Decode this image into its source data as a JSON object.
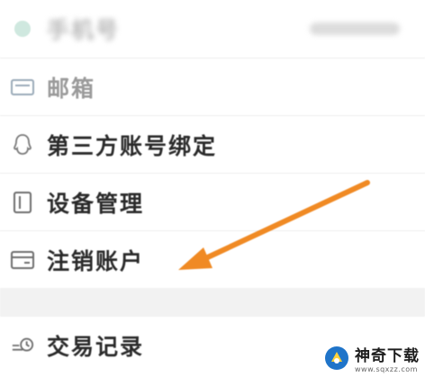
{
  "menu": {
    "top_label": "手机号",
    "mailbox_label": "邮箱",
    "third_party_label": "第三方账号绑定",
    "devices_label": "设备管理",
    "cancel_account_label": "注销账户",
    "transactions_label": "交易记录"
  },
  "watermark": {
    "title": "神奇下载",
    "url": "www.sqxzz.com"
  },
  "colors": {
    "arrow": "#f08a24",
    "section_gap": "#f2f2f2",
    "icon_stroke": "#7a7a7a"
  },
  "icons": {
    "mailbox": "mail-icon",
    "third_party": "qq-penguin-icon",
    "devices": "device-icon",
    "cancel_account": "card-icon",
    "transactions": "transaction-icon"
  }
}
